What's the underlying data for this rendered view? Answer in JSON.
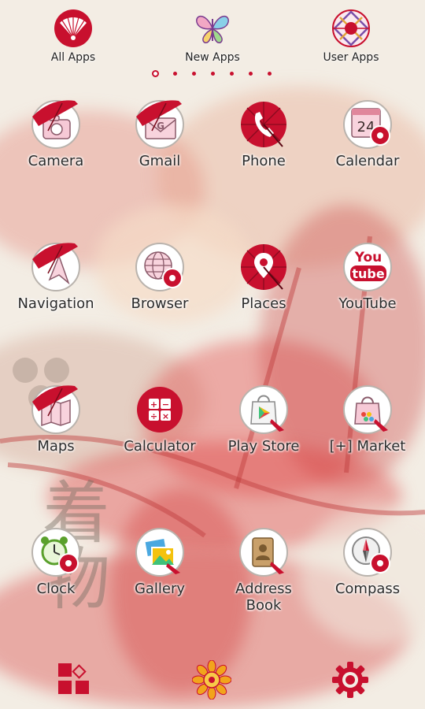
{
  "top_bar": {
    "items": [
      {
        "label": "All Apps",
        "icon": "folding-fan-icon"
      },
      {
        "label": "New Apps",
        "icon": "butterfly-icon"
      },
      {
        "label": "User Apps",
        "icon": "temari-ball-icon"
      }
    ],
    "pages": {
      "count": 7,
      "active": 0
    }
  },
  "apps": [
    {
      "label": "Camera",
      "icon": "camera-icon"
    },
    {
      "label": "Gmail",
      "icon": "gmail-icon"
    },
    {
      "label": "Phone",
      "icon": "phone-icon"
    },
    {
      "label": "Calendar",
      "icon": "calendar-icon",
      "date": "24"
    },
    {
      "label": "Navigation",
      "icon": "navigation-icon"
    },
    {
      "label": "Browser",
      "icon": "browser-icon"
    },
    {
      "label": "Places",
      "icon": "places-icon"
    },
    {
      "label": "YouTube",
      "icon": "youtube-icon",
      "badge_top": "You",
      "badge_bottom": "tube"
    },
    {
      "label": "Maps",
      "icon": "maps-icon"
    },
    {
      "label": "Calculator",
      "icon": "calculator-icon",
      "keys": [
        "+",
        "−",
        "÷",
        "×"
      ]
    },
    {
      "label": "Play Store",
      "icon": "play-store-icon"
    },
    {
      "label": "[+] Market",
      "icon": "market-icon"
    },
    {
      "label": "Clock",
      "icon": "clock-icon"
    },
    {
      "label": "Gallery",
      "icon": "gallery-icon"
    },
    {
      "label": "Address\nBook",
      "icon": "address-book-icon"
    },
    {
      "label": "Compass",
      "icon": "compass-icon"
    }
  ],
  "wallpaper_text": "着物",
  "dock": [
    {
      "icon": "app-drawer-icon"
    },
    {
      "icon": "chrysanthemum-icon"
    },
    {
      "icon": "settings-gear-icon"
    }
  ],
  "colors": {
    "accent": "#c8102e",
    "label": "#2b2b2b",
    "background": "#f3ede4"
  }
}
